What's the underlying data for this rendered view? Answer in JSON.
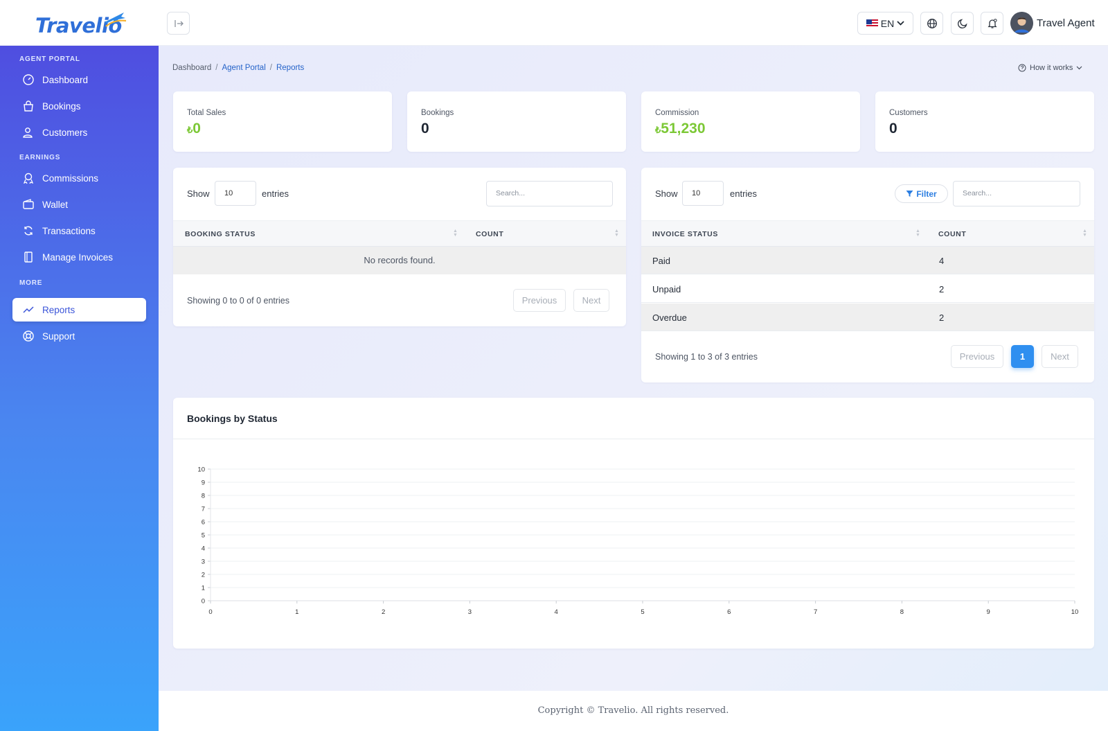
{
  "app": {
    "logo_text": "Travelio"
  },
  "header": {
    "language": "EN",
    "user_name": "Travel Agent"
  },
  "sidebar": {
    "sections": [
      {
        "title": "AGENT PORTAL"
      },
      {
        "title": "EARNINGS"
      },
      {
        "title": "MORE"
      }
    ],
    "items": [
      {
        "label": "Dashboard",
        "icon": "dashboard-icon"
      },
      {
        "label": "Bookings",
        "icon": "bag-icon"
      },
      {
        "label": "Customers",
        "icon": "users-icon"
      },
      {
        "label": "Commissions",
        "icon": "award-icon"
      },
      {
        "label": "Wallet",
        "icon": "wallet-icon"
      },
      {
        "label": "Transactions",
        "icon": "refresh-icon"
      },
      {
        "label": "Manage Invoices",
        "icon": "invoice-icon"
      },
      {
        "label": "Reports",
        "icon": "trend-icon",
        "active": true
      },
      {
        "label": "Support",
        "icon": "lifebuoy-icon"
      }
    ]
  },
  "breadcrumb": {
    "items": [
      "Dashboard",
      "Agent Portal",
      "Reports"
    ]
  },
  "how_it_works": "How it works",
  "stats": [
    {
      "label": "Total Sales",
      "currency": "₺",
      "value": "0",
      "color": "#7cc836"
    },
    {
      "label": "Bookings",
      "currency": "",
      "value": "0",
      "color": "#1f2733"
    },
    {
      "label": "Commission",
      "currency": "₺",
      "value": "51,230",
      "color": "#7cc836"
    },
    {
      "label": "Customers",
      "currency": "",
      "value": "0",
      "color": "#1f2733"
    }
  ],
  "booking_table": {
    "show_label": "Show",
    "entries_label": "entries",
    "page_size": "10",
    "search_placeholder": "Search...",
    "columns": [
      "BOOKING STATUS",
      "COUNT"
    ],
    "rows": [],
    "empty_text": "No records found.",
    "info": "Showing 0 to 0 of 0 entries",
    "prev": "Previous",
    "next": "Next"
  },
  "invoice_table": {
    "show_label": "Show",
    "entries_label": "entries",
    "page_size": "10",
    "filter_label": "Filter",
    "search_placeholder": "Search...",
    "columns": [
      "INVOICE STATUS",
      "COUNT"
    ],
    "rows": [
      {
        "status": "Paid",
        "count": "4"
      },
      {
        "status": "Unpaid",
        "count": "2"
      },
      {
        "status": "Overdue",
        "count": "2"
      }
    ],
    "info": "Showing 1 to 3 of 3 entries",
    "prev": "Previous",
    "page": "1",
    "next": "Next"
  },
  "chart_data": {
    "type": "bar",
    "title": "Bookings by Status",
    "xlabel": "",
    "ylabel": "",
    "x_ticks": [
      "0",
      "1",
      "2",
      "3",
      "4",
      "5",
      "6",
      "7",
      "8",
      "9",
      "10"
    ],
    "y_ticks": [
      "0",
      "1",
      "2",
      "3",
      "4",
      "5",
      "6",
      "7",
      "8",
      "9",
      "10"
    ],
    "xlim": [
      0,
      10
    ],
    "ylim": [
      0,
      10
    ],
    "categories": [],
    "values": [],
    "grid": true
  },
  "footer": {
    "text": "Copyright © Travelio. All rights reserved."
  }
}
